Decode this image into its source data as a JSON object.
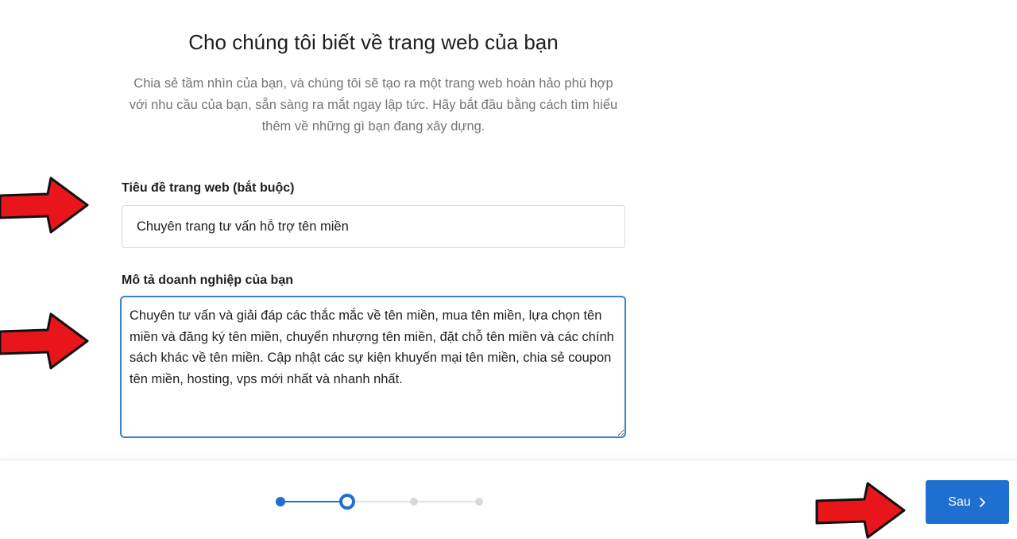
{
  "header": {
    "title": "Cho chúng tôi biết về trang web của bạn",
    "intro": "Chia sẻ tầm nhìn của bạn, và chúng tôi sẽ tạo ra một trang web hoàn hảo phù hợp với nhu cầu của bạn, sẵn sàng ra mắt ngay lập tức. Hãy bắt đầu bằng cách tìm hiểu thêm về những gì bạn đang xây dựng."
  },
  "form": {
    "site_title_label": "Tiêu đề trang web (bắt buộc)",
    "site_title_value": "Chuyên trang tư vấn hỗ trợ tên miền",
    "description_label": "Mô tả doanh nghiệp của bạn",
    "description_value": "Chuyên tư vấn và giải đáp các thắc mắc về tên miền, mua tên miền, lựa chọn tên miền và đăng ký tên miền, chuyển nhượng tên miền, đặt chỗ tên miền và các chính sách khác về tên miền. Cập nhật các sự kiện khuyến mại tên miền, chia sẻ coupon tên miền, hosting, vps mới nhất và nhanh nhất."
  },
  "stepper": {
    "total_steps": 4,
    "current_step": 2
  },
  "footer": {
    "next_label": "Sau"
  },
  "icons": {
    "next": "chevron-right-icon",
    "annotation": "red-arrow-icon"
  },
  "colors": {
    "accent": "#1e6fcf",
    "focus_border": "#3a7fd1",
    "annotation_red": "#e8151b"
  }
}
